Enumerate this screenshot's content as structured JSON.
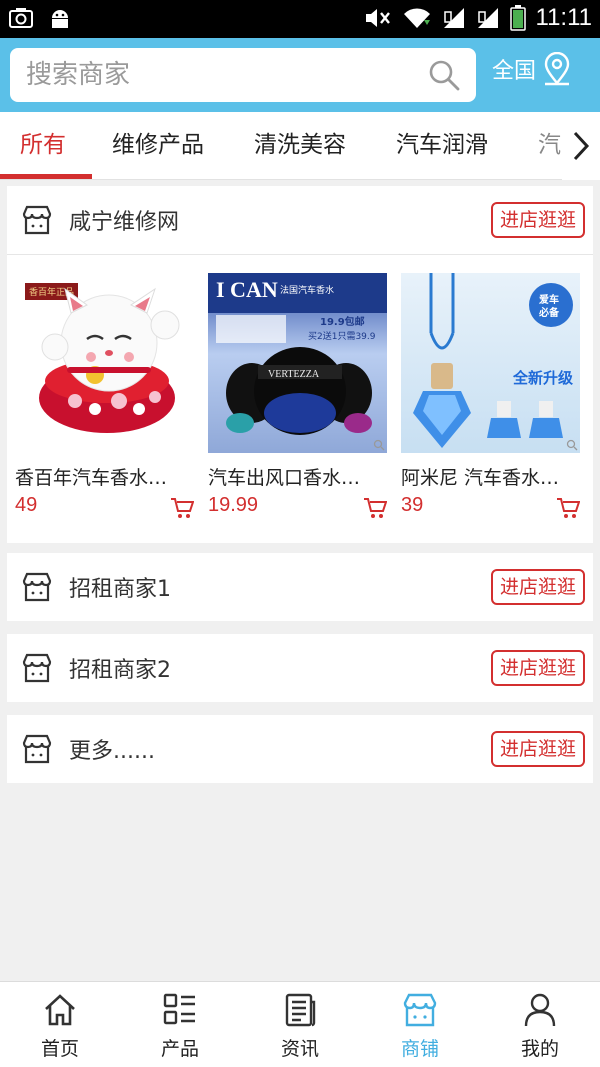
{
  "status_bar": {
    "time": "11:11"
  },
  "header": {
    "search_placeholder": "搜索商家",
    "region_label": "全国"
  },
  "tabs": [
    {
      "label": "所有",
      "active": true
    },
    {
      "label": "维修产品"
    },
    {
      "label": "清洗美容"
    },
    {
      "label": "汽车润滑"
    },
    {
      "label": "汽"
    }
  ],
  "shops": [
    {
      "name": "咸宁维修网",
      "button": "进店逛逛",
      "products": [
        {
          "title": "香百年汽车香水…",
          "price": "49",
          "image_text": "香百年正品"
        },
        {
          "title": "汽车出风口香水…",
          "price": "19.99",
          "image_text": "I CAN 法国汽车香水 VERTEZZA 19.9包邮 买2送1只需39.9"
        },
        {
          "title": "阿米尼 汽车香水 …",
          "price": "39",
          "image_text": "爱车必备 全新升级"
        }
      ]
    },
    {
      "name": "招租商家1",
      "button": "进店逛逛"
    },
    {
      "name": "招租商家2",
      "button": "进店逛逛"
    },
    {
      "name": "更多......",
      "button": "进店逛逛"
    }
  ],
  "bottom_nav": [
    {
      "label": "首页",
      "icon": "home-icon"
    },
    {
      "label": "产品",
      "icon": "product-list-icon"
    },
    {
      "label": "资讯",
      "icon": "news-icon"
    },
    {
      "label": "商铺",
      "icon": "shop-icon",
      "active": true
    },
    {
      "label": "我的",
      "icon": "user-icon"
    }
  ],
  "colors": {
    "accent": "#d32f2f",
    "header": "#5bc0e8",
    "nav_active": "#42aee0"
  }
}
